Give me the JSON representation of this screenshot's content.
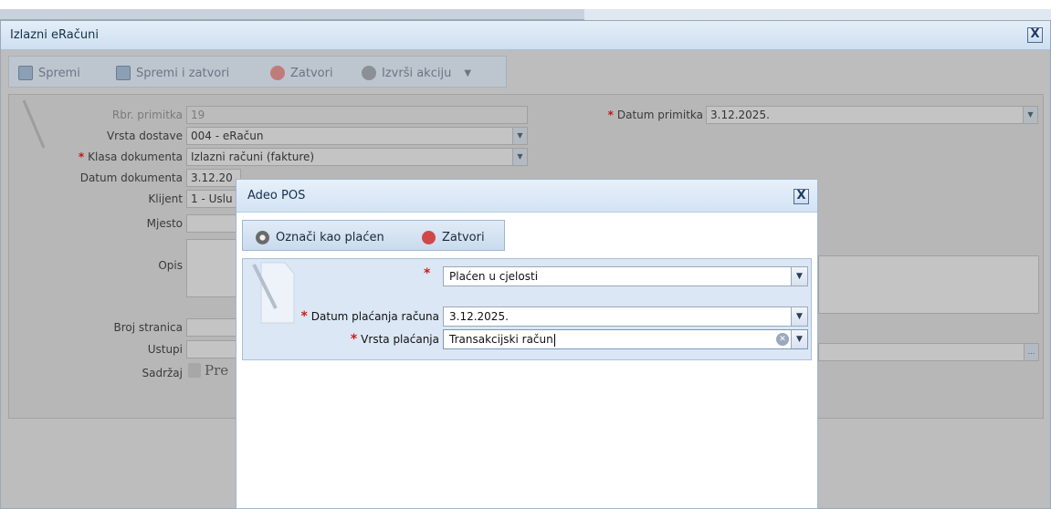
{
  "window": {
    "title": "Izlazni eRačuni",
    "close_glyph": "X"
  },
  "toolbar": {
    "save_label": "Spremi",
    "save_close_label": "Spremi i zatvori",
    "close_label": "Zatvori",
    "action_label": "Izvrši akciju",
    "action_chevron": "▼"
  },
  "form": {
    "rbr_label": "Rbr. primitka",
    "rbr_value": "19",
    "vrsta_dostave_label": "Vrsta dostave",
    "vrsta_dostave_value": "004 - eRačun",
    "klasa_label": "Klasa dokumenta",
    "klasa_value": "Izlazni računi (fakture)",
    "datum_dok_label": "Datum dokumenta",
    "datum_dok_value": "3.12.20",
    "klijent_label": "Klijent",
    "klijent_value": "1 - Uslu",
    "mjesto_label": "Mjesto",
    "opis_label": "Opis",
    "broj_stranica_label": "Broj stranica",
    "ustupi_label": "Ustupi",
    "ustupi_ellipsis": "...",
    "sadrzaj_label": "Sadržaj",
    "sadrzaj_value": "Pre",
    "datum_primitka_label": "Datum primitka",
    "datum_primitka_value": "3.12.2025.",
    "required_mark": "*",
    "dropdown_glyph": "▼"
  },
  "dialog": {
    "title": "Adeo POS",
    "close_glyph": "X",
    "mark_paid_label": "Označi kao plaćen",
    "close_label": "Zatvori",
    "status_value": "Plaćen u cjelosti",
    "datum_placanja_label": "Datum plaćanja računa",
    "datum_placanja_value": "3.12.2025.",
    "vrsta_placanja_label": "Vrsta plaćanja",
    "vrsta_placanja_value": "Transakcijski račun",
    "required_mark": "*",
    "dropdown_glyph": "▼",
    "clear_glyph": "✕"
  },
  "colors": {
    "required": "#d01a1a",
    "title_text": "#15314c",
    "dialog_form_bg": "#dbe7f5"
  }
}
